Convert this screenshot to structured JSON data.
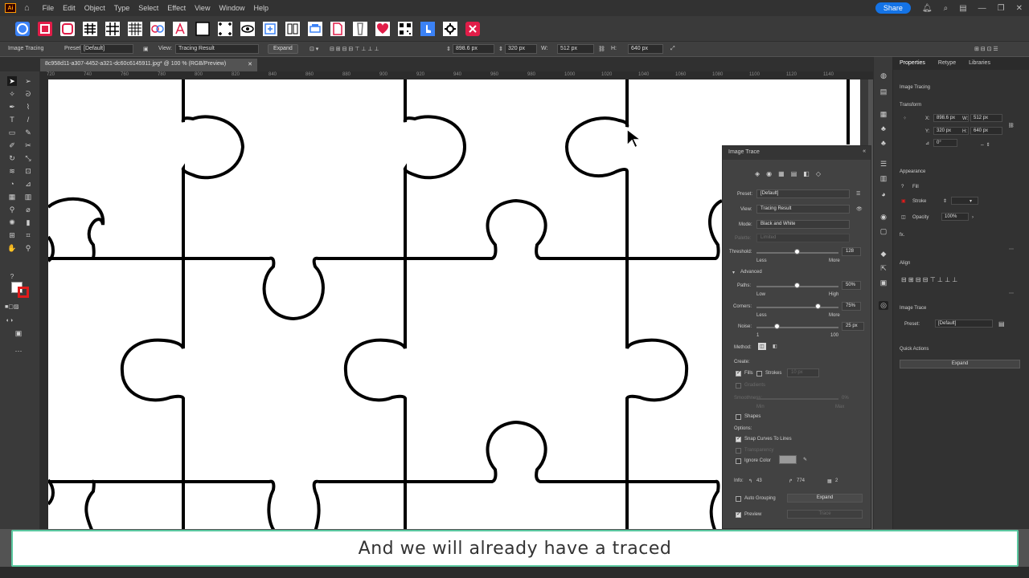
{
  "menubar": {
    "logo": "Ai",
    "items": [
      "File",
      "Edit",
      "Object",
      "Type",
      "Select",
      "Effect",
      "View",
      "Window",
      "Help"
    ],
    "share_label": "Share"
  },
  "controlbar": {
    "context": "Image Tracing",
    "preset_label": "Preset:",
    "preset_value": "[Default]",
    "view_label": "View:",
    "view_value": "Tracing Result",
    "expand_label": "Expand",
    "x": "898.6 px",
    "y": "320 px",
    "w_label": "W:",
    "w": "512 px",
    "h_label": "H:",
    "h": "640 px"
  },
  "document": {
    "tab_title": "8c958d11-a307-4452-a321-dc60c6145911.jpg* @ 100 % (RGB/Preview)",
    "ruler_ticks": [
      "720",
      "740",
      "760",
      "780",
      "800",
      "820",
      "840",
      "860",
      "880",
      "900",
      "920",
      "940",
      "960",
      "980",
      "1000",
      "1020",
      "1040",
      "1060",
      "1080",
      "1100",
      "1120",
      "1140"
    ]
  },
  "image_trace": {
    "title": "Image Trace",
    "preset_label": "Preset:",
    "preset_value": "[Default]",
    "view_label": "View:",
    "view_value": "Tracing Result",
    "mode_label": "Mode:",
    "mode_value": "Black and White",
    "palette_label": "Palette:",
    "palette_value": "Limited",
    "threshold_label": "Threshold:",
    "threshold_value": "128",
    "threshold_fraction": 0.5,
    "threshold_less": "Less",
    "threshold_more": "More",
    "advanced_label": "Advanced",
    "paths_label": "Paths:",
    "paths_value": "50%",
    "paths_fraction": 0.5,
    "paths_low": "Low",
    "paths_high": "High",
    "corners_label": "Corners:",
    "corners_value": "75%",
    "corners_fraction": 0.75,
    "corners_less": "Less",
    "corners_more": "More",
    "noise_label": "Noise:",
    "noise_value": "25 px",
    "noise_fraction": 0.25,
    "noise_min": "1",
    "noise_max": "100",
    "method_label": "Method:",
    "create_label": "Create:",
    "fills_label": "Fills",
    "strokes_label": "Strokes",
    "stroke_value": "10 px",
    "gradients_label": "Gradients",
    "smoothness_label": "Smoothness:",
    "smoothness_value": "0%",
    "smoothness_min": "Min",
    "smoothness_max": "Max",
    "shapes_label": "Shapes",
    "options_label": "Options:",
    "snap_label": "Snap Curves To Lines",
    "transparency_label": "Transparency",
    "ignore_color_label": "Ignore Color",
    "info_label": "Info:",
    "info_paths": "43",
    "info_anchors": "774",
    "info_colors": "2",
    "auto_grouping_label": "Auto Grouping",
    "expand_label": "Expand",
    "preview_label": "Preview",
    "trace_label": "Trace"
  },
  "properties": {
    "tabs": [
      "Properties",
      "Retype",
      "Libraries"
    ],
    "context": "Image Tracing",
    "transform_label": "Transform",
    "x_label": "X:",
    "x": "898.6 px",
    "y_label": "Y:",
    "y": "320 px",
    "w_label": "W:",
    "w": "512 px",
    "h_label": "H:",
    "h": "640 px",
    "angle": "0°",
    "appearance_label": "Appearance",
    "fill_label": "Fill",
    "stroke_label": "Stroke",
    "opacity_label": "Opacity",
    "opacity_value": "100%",
    "fx_label": "fx.",
    "align_label": "Align",
    "image_trace_label": "Image Trace",
    "preset_label": "Preset:",
    "preset_value": "[Default]",
    "quick_actions_label": "Quick Actions",
    "expand_label": "Expand"
  },
  "caption": "And we will already have a traced",
  "colors": {
    "caption_border": "#5bc8a0",
    "share": "#1473e6",
    "ai_logo": "#ff9a00"
  }
}
